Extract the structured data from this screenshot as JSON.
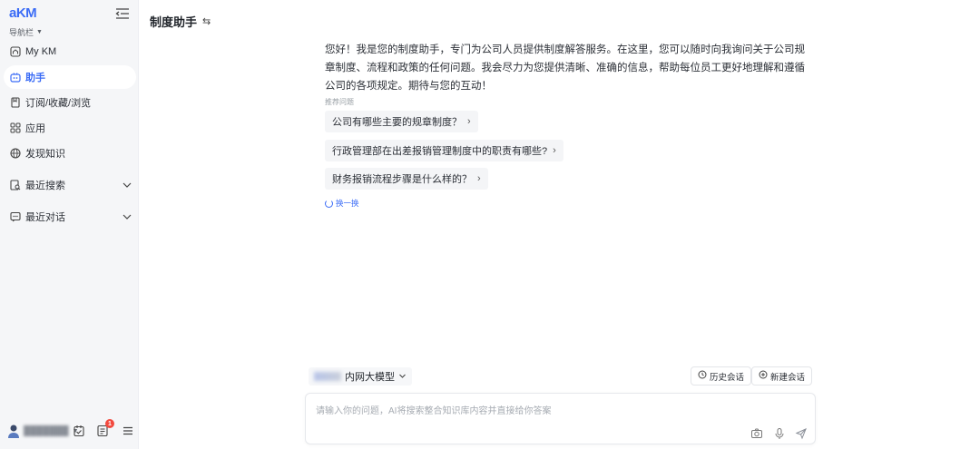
{
  "sidebar": {
    "logo": "aKM",
    "nav_caption": "导航栏",
    "items": [
      {
        "label": "My KM",
        "icon": "home-icon"
      },
      {
        "label": "助手",
        "icon": "robot-icon"
      },
      {
        "label": "订阅/收藏/浏览",
        "icon": "bookmark-icon"
      },
      {
        "label": "应用",
        "icon": "apps-icon"
      },
      {
        "label": "发现知识",
        "icon": "globe-icon"
      },
      {
        "label": "最近搜索",
        "icon": "search-doc-icon"
      },
      {
        "label": "最近对话",
        "icon": "chat-icon"
      }
    ],
    "active_index": 1,
    "badge_count": "1",
    "accent_color": "#3b6cf6"
  },
  "header": {
    "title": "制度助手",
    "switch_icon": "⇆"
  },
  "chat": {
    "welcome": "您好！我是您的制度助手，专门为公司人员提供制度解答服务。在这里，您可以随时向我询问关于公司规章制度、流程和政策的任何问题。我会尽力为您提供清晰、准确的信息，帮助每位员工更好地理解和遵循公司的各项规定。期待与您的互动！",
    "suggest_caption": "推荐问题",
    "suggestions": [
      "公司有哪些主要的规章制度？",
      "行政管理部在出差报销管理制度中的职责有哪些?",
      "财务报销流程步骤是什么样的？"
    ],
    "refresh_label": "换一换"
  },
  "composer": {
    "model_label": "内网大模型",
    "history_label": "历史会话",
    "new_chat_label": "新建会话",
    "placeholder": "请输入你的问题，AI将搜索整合知识库内容并直接给你答案",
    "value": ""
  }
}
